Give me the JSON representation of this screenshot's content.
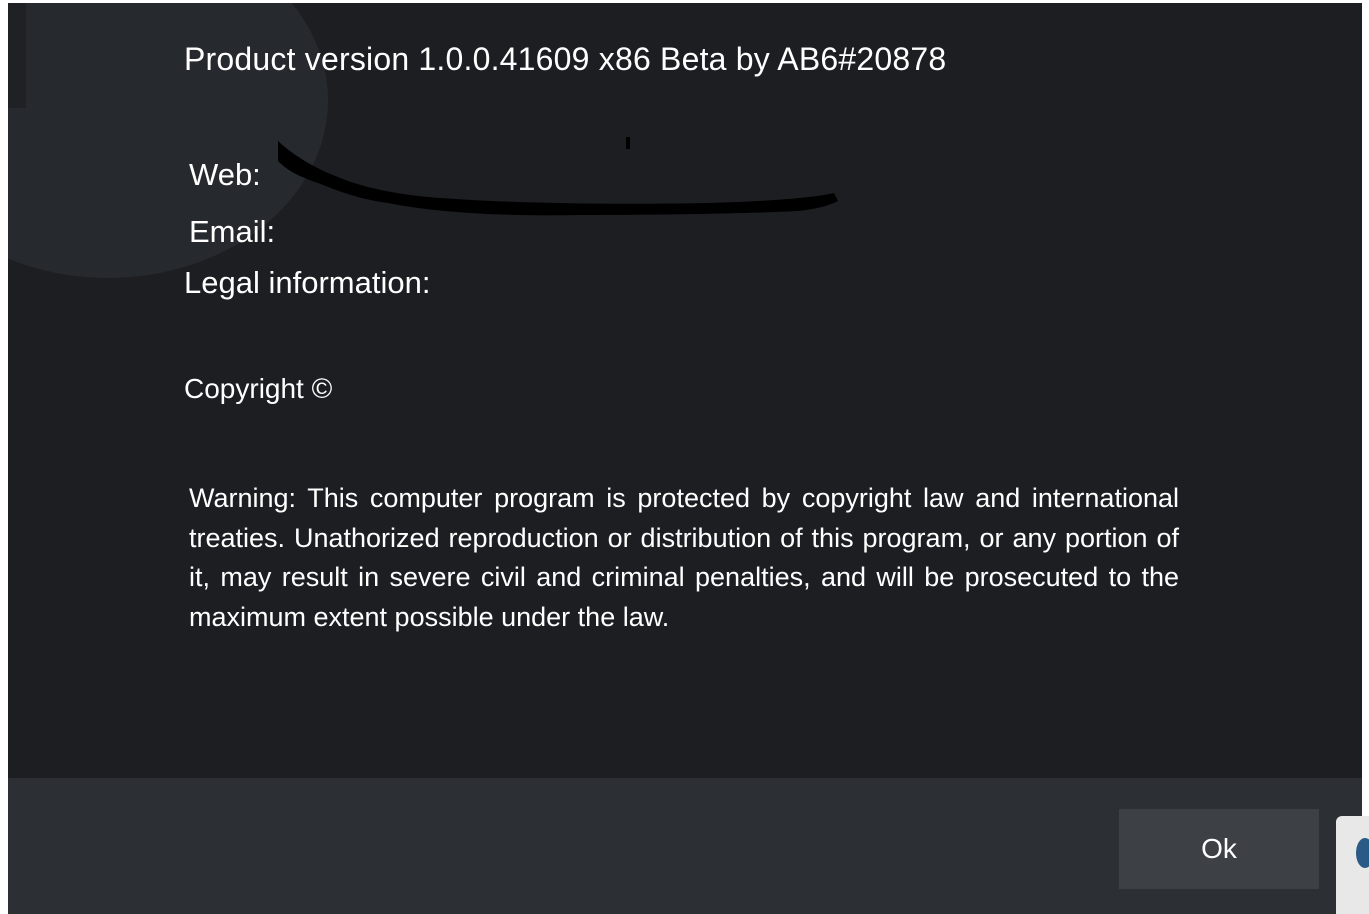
{
  "dialog": {
    "product_version": "Product version 1.0.0.41609 x86 Beta by AB6#20878",
    "web_label": "Web:",
    "email_label": "Email:",
    "legal_label": "Legal information:",
    "copyright": "Copyright ©",
    "warning": "Warning: This computer program is protected by copyright law and international treaties. Unathorized reproduction or distribution of this program, or any portion of it, may result in severe civil and criminal penalties, and will be prosecuted to the maximum extent possible under the law.",
    "ok_label": "Ok"
  },
  "colors": {
    "dialog_background": "#1c1e21",
    "footer_background": "#2c2f33",
    "button_background": "#3d4045",
    "text": "#ffffff"
  },
  "icons": {
    "watermark": "info-icon"
  }
}
